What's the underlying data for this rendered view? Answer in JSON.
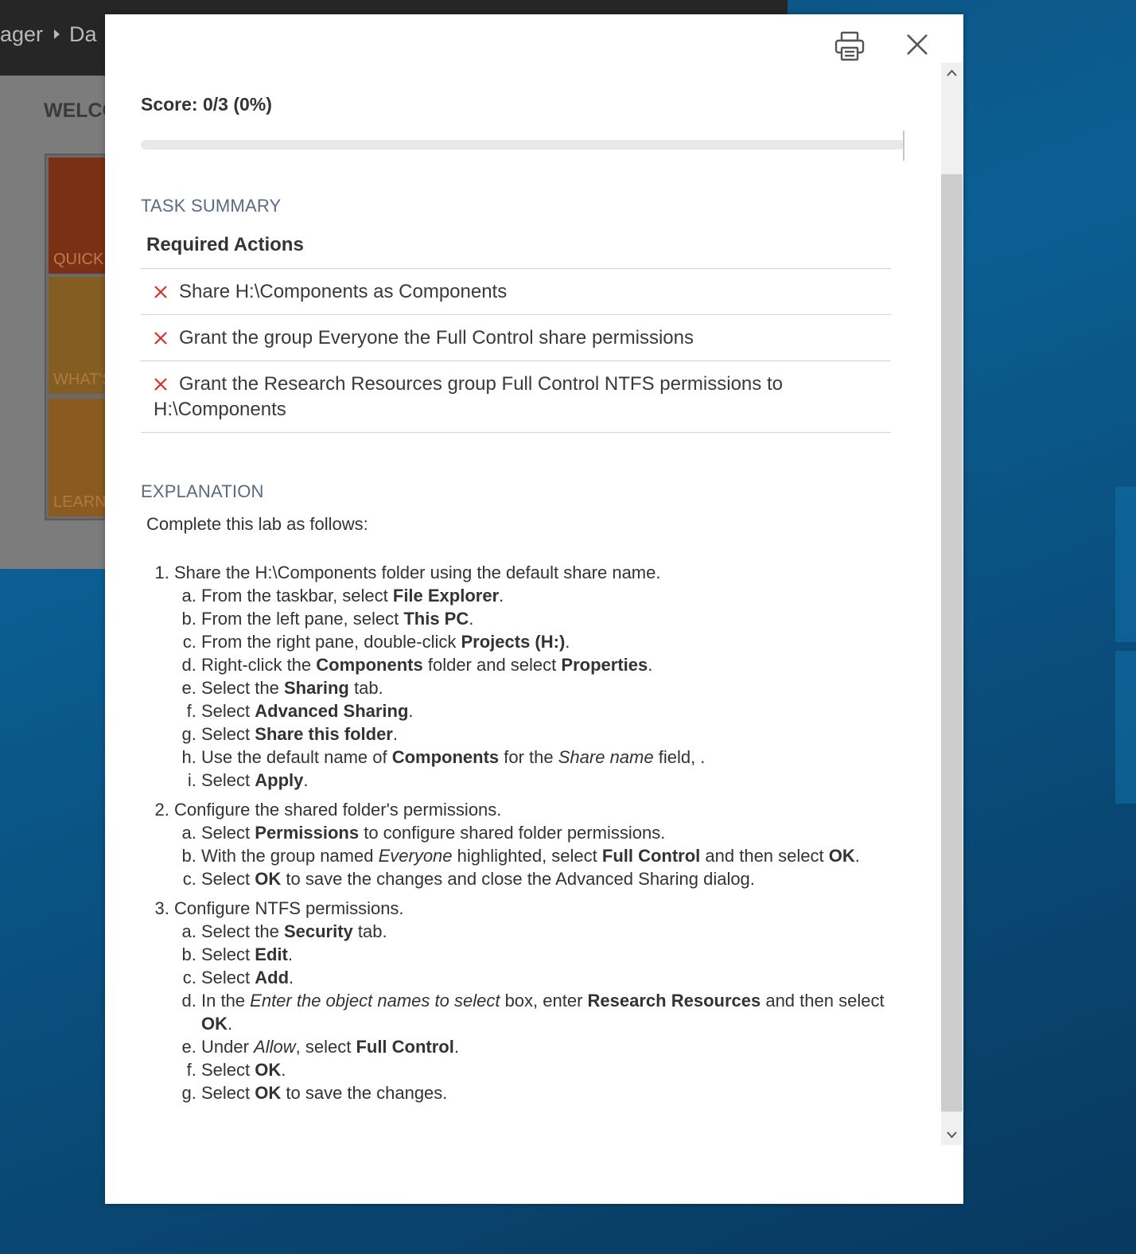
{
  "background": {
    "breadcrumb": [
      "ager",
      "Da"
    ],
    "welcome": "WELCO",
    "tiles": [
      "QUICK S",
      "WHAT'S",
      "LEARN I"
    ]
  },
  "modal": {
    "score_label": "Score: 0/3 (0%)",
    "score_fraction": 0.0,
    "task_summary_heading": "TASK SUMMARY",
    "required_actions_heading": "Required Actions",
    "tasks": [
      {
        "status": "failed",
        "text": "Share H:\\Components as Components"
      },
      {
        "status": "failed",
        "text": "Grant the group Everyone the Full Control share permissions"
      },
      {
        "status": "failed",
        "text": "Grant the Research Resources group Full Control NTFS permissions to H:\\Components"
      }
    ],
    "explanation_heading": "EXPLANATION",
    "explanation_intro": "Complete this lab as follows:",
    "steps": [
      {
        "title": "Share the H:\\Components folder using the default share name.",
        "sub": [
          [
            {
              "t": "From the taskbar, select "
            },
            {
              "b": "File Explorer"
            },
            {
              "t": "."
            }
          ],
          [
            {
              "t": "From the left pane, select "
            },
            {
              "b": "This PC"
            },
            {
              "t": "."
            }
          ],
          [
            {
              "t": "From the right pane, double-click "
            },
            {
              "b": "Projects (H:)"
            },
            {
              "t": "."
            }
          ],
          [
            {
              "t": "Right-click the "
            },
            {
              "b": "Components"
            },
            {
              "t": " folder and select "
            },
            {
              "b": "Properties"
            },
            {
              "t": "."
            }
          ],
          [
            {
              "t": "Select the "
            },
            {
              "b": "Sharing"
            },
            {
              "t": " tab."
            }
          ],
          [
            {
              "t": "Select "
            },
            {
              "b": "Advanced Sharing"
            },
            {
              "t": "."
            }
          ],
          [
            {
              "t": "Select "
            },
            {
              "b": "Share this folder"
            },
            {
              "t": "."
            }
          ],
          [
            {
              "t": "Use the default name of "
            },
            {
              "b": "Components"
            },
            {
              "t": " for the "
            },
            {
              "i": "Share name"
            },
            {
              "t": " field, ."
            }
          ],
          [
            {
              "t": "Select "
            },
            {
              "b": "Apply"
            },
            {
              "t": "."
            }
          ]
        ]
      },
      {
        "title": "Configure the shared folder's permissions.",
        "sub": [
          [
            {
              "t": "Select "
            },
            {
              "b": "Permissions"
            },
            {
              "t": " to configure shared folder permissions."
            }
          ],
          [
            {
              "t": "With the group named "
            },
            {
              "i": "Everyone"
            },
            {
              "t": " highlighted, select "
            },
            {
              "b": "Full Control"
            },
            {
              "t": " and then select "
            },
            {
              "b": "OK"
            },
            {
              "t": "."
            }
          ],
          [
            {
              "t": "Select "
            },
            {
              "b": "OK"
            },
            {
              "t": " to save the changes and close the Advanced Sharing dialog."
            }
          ]
        ]
      },
      {
        "title": "Configure NTFS permissions.",
        "sub": [
          [
            {
              "t": "Select the "
            },
            {
              "b": "Security"
            },
            {
              "t": " tab."
            }
          ],
          [
            {
              "t": "Select "
            },
            {
              "b": "Edit"
            },
            {
              "t": "."
            }
          ],
          [
            {
              "t": "Select "
            },
            {
              "b": "Add"
            },
            {
              "t": "."
            }
          ],
          [
            {
              "t": "In the "
            },
            {
              "i": "Enter the object names to select"
            },
            {
              "t": " box, enter "
            },
            {
              "b": "Research Resources"
            },
            {
              "t": " and then select "
            },
            {
              "b": "OK"
            },
            {
              "t": "."
            }
          ],
          [
            {
              "t": "Under "
            },
            {
              "i": "Allow"
            },
            {
              "t": ", select "
            },
            {
              "b": "Full Control"
            },
            {
              "t": "."
            }
          ],
          [
            {
              "t": "Select "
            },
            {
              "b": "OK"
            },
            {
              "t": "."
            }
          ],
          [
            {
              "t": "Select "
            },
            {
              "b": "OK"
            },
            {
              "t": " to save the changes."
            }
          ]
        ]
      }
    ]
  },
  "icons": {
    "print": "printer-icon",
    "close": "close-icon",
    "fail": "x-mark-icon"
  },
  "colors": {
    "fail": "#d9302b",
    "heading": "#5a6a82"
  }
}
